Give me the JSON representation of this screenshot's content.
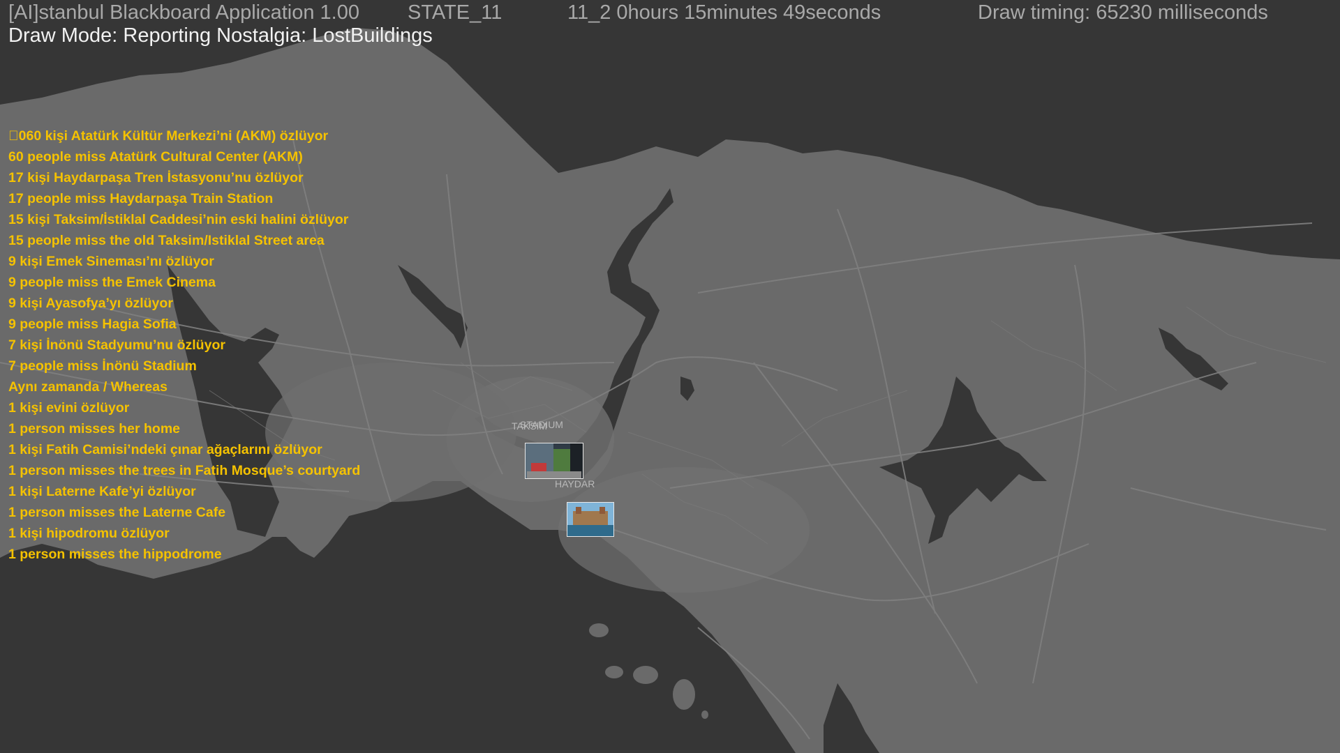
{
  "header": {
    "app_title": "[AI]stanbul Blackboard Application 1.00",
    "state": "STATE_11",
    "elapsed": "11_2  0hours 15minutes 49seconds",
    "draw_timing": "Draw timing: 65230 milliseconds"
  },
  "mode_line": "Draw Mode: Reporting Nostalgia: LostBuildings",
  "report_lines": [
    "\u0000060 kişi Atatürk Kültür Merkezi’ni (AKM) özlüyor",
    "60 people miss Atatürk Cultural Center (AKM)",
    "17 kişi Haydarpaşa Tren İstasyonu’nu özlüyor",
    "17 people miss Haydarpaşa Train Station",
    "15 kişi Taksim/İstiklal Caddesi’nin eski halini özlüyor",
    "15 people miss the old Taksim/Istiklal Street area",
    "9 kişi Emek Sineması’nı özlüyor",
    "9 people miss the Emek Cinema",
    "9 kişi Ayasofya’yı özlüyor",
    "9 people miss Hagia Sofia",
    "7 kişi İnönü Stadyumu’nu özlüyor",
    "7 people miss İnönü Stadium",
    "Aynı zamanda / Whereas",
    "1 kişi evini özlüyor",
    "1 person misses her home",
    "1 kişi Fatih Camisi’ndeki çınar ağaçlarını özlüyor",
    "1 person misses the trees in Fatih Mosque’s courtyard",
    "1 kişi Laterne Kafe’yi özlüyor",
    "1 person misses the Laterne Cafe",
    "1 kişi hipodromu özlüyor",
    "1 person misses the hippodrome"
  ],
  "map_labels": {
    "stadium": "STADIUM",
    "taksim": "TAKSIM",
    "haydar": "HAYDAR"
  },
  "colors": {
    "water": "#363636",
    "land": "#6a6a6a",
    "roads": "#7d7d7d",
    "report_text": "#f5c200",
    "header_text": "#a9a9a9"
  }
}
